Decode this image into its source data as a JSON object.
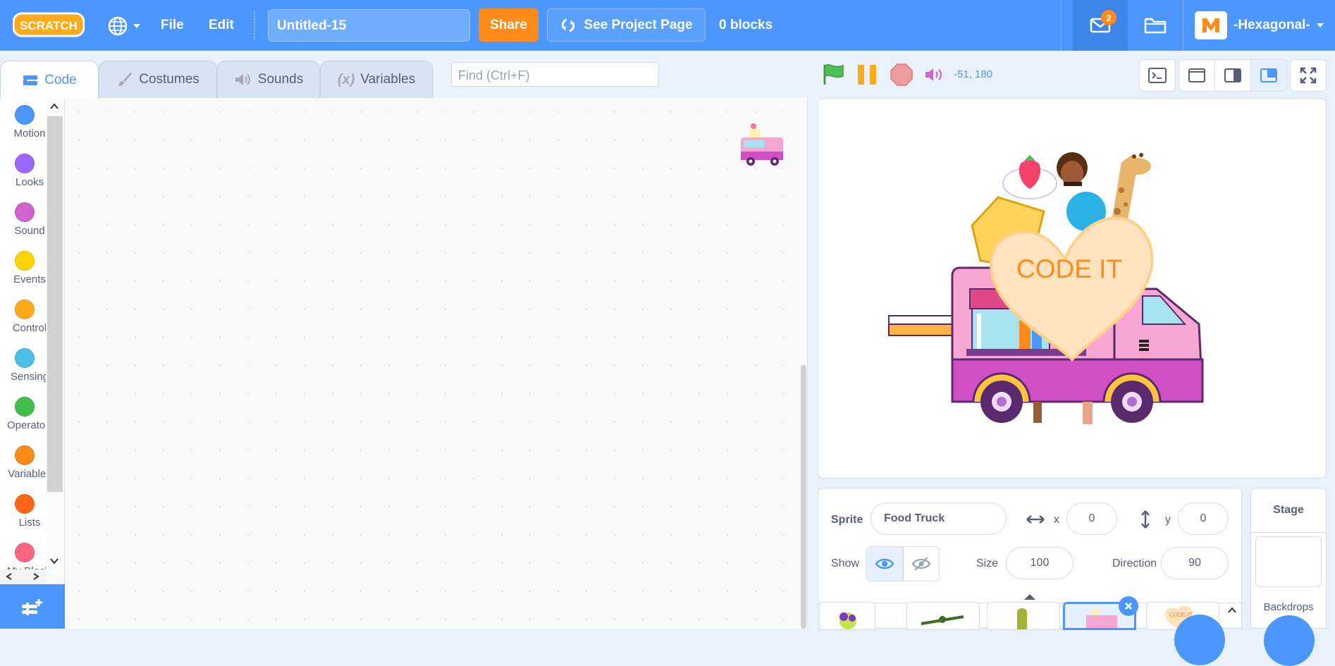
{
  "menubar": {
    "logo_text": "SCRATCH",
    "file_label": "File",
    "edit_label": "Edit",
    "project_title": "Untitled-15",
    "share_label": "Share",
    "see_project_label": "See Project Page",
    "blocks_count": "0 blocks",
    "messages_count": "2",
    "username": "-Hexagonal-"
  },
  "tabs": {
    "code": "Code",
    "costumes": "Costumes",
    "sounds": "Sounds",
    "variables": "Variables"
  },
  "find": {
    "placeholder": "Find (Ctrl+F)"
  },
  "categories": [
    {
      "label": "Motion",
      "color": "#4c97ff"
    },
    {
      "label": "Looks",
      "color": "#9966ff"
    },
    {
      "label": "Sound",
      "color": "#cf63cf"
    },
    {
      "label": "Events",
      "color": "#ffd500"
    },
    {
      "label": "Control",
      "color": "#ffab19"
    },
    {
      "label": "Sensing",
      "color": "#4cbfe6"
    },
    {
      "label": "Operators",
      "color": "#40bf4a"
    },
    {
      "label": "Variables",
      "color": "#ff8c1a"
    },
    {
      "label": "Lists",
      "color": "#ff661a"
    },
    {
      "label": "My Blocks",
      "color": "#ff6680"
    }
  ],
  "stage": {
    "coords": "-51, 180",
    "heart_text": "CODE IT"
  },
  "sprite": {
    "sprite_label": "Sprite",
    "name": "Food Truck",
    "x_label": "x",
    "x_value": "0",
    "y_label": "y",
    "y_value": "0",
    "show_label": "Show",
    "size_label": "Size",
    "size_value": "100",
    "direction_label": "Direction",
    "direction_value": "90"
  },
  "stage_panel": {
    "title": "Stage",
    "backdrops_label": "Backdrops"
  },
  "sprite_thumbs": {
    "heart_thumb_text": "CODE IT"
  },
  "colors": {
    "menubar": "#4c97ff",
    "share": "#ff8c1a",
    "accent": "#4c97ff"
  }
}
